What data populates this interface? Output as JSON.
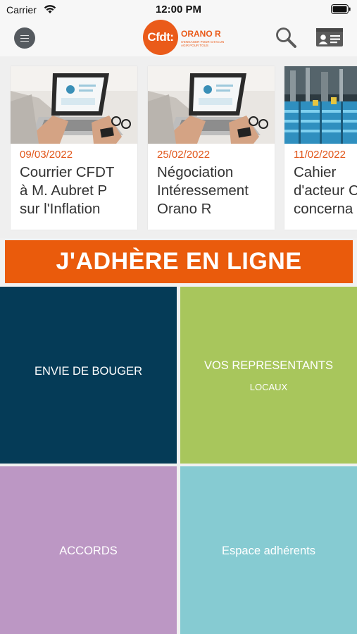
{
  "status_bar": {
    "carrier": "Carrier",
    "time": "12:00 PM"
  },
  "header": {
    "menu_icon": "menu-icon",
    "logo": {
      "mark": "Cfdt:",
      "name": "ORANO R",
      "tagline_1": "S'ENGAGER POUR CHACUN",
      "tagline_2": "AGIR POUR TOUS"
    },
    "search_icon": "search-icon",
    "card_icon": "id-card-icon"
  },
  "news": [
    {
      "date": "09/03/2022",
      "title": "Courrier CFDT\nà M. Aubret P\nsur l'Inflation"
    },
    {
      "date": "25/02/2022",
      "title": "Négociation\nIntéressement\nOrano R"
    },
    {
      "date": "11/02/2022",
      "title": "Cahier\nd'acteur C\nconcerna"
    }
  ],
  "banner": {
    "text": "J'ADHÈRE EN LIGNE"
  },
  "tiles": [
    {
      "label": "ENVIE DE BOUGER",
      "sub": "",
      "color": "#053b57"
    },
    {
      "label": "VOS REPRESENTANTS",
      "sub": "LOCAUX",
      "color": "#a8c65c"
    },
    {
      "label": "ACCORDS",
      "sub": "",
      "color": "#bc97c4"
    },
    {
      "label": "Espace adhérents",
      "sub": "",
      "color": "#86cbd2"
    }
  ],
  "colors": {
    "accent": "#ea5b0c",
    "date": "#e1561a"
  }
}
